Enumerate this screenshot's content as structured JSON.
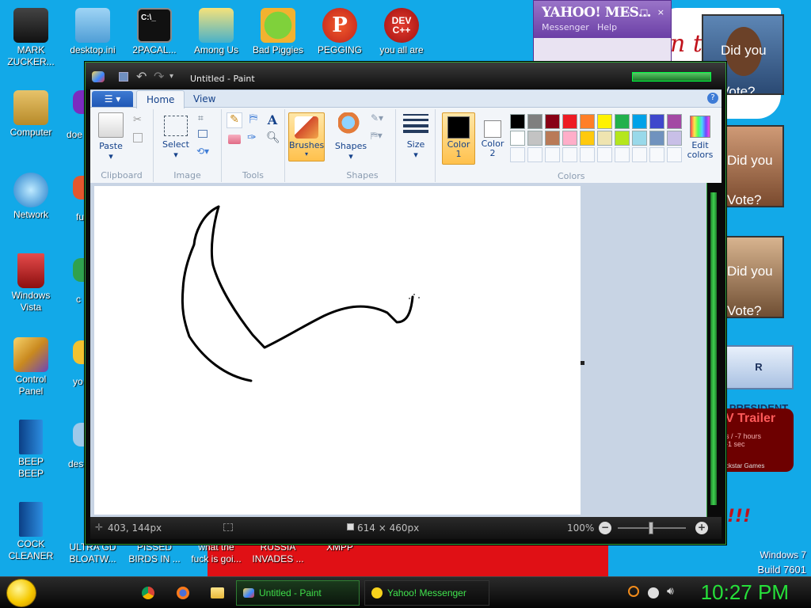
{
  "desktop": {
    "top_icons": [
      {
        "label": "MARK\nZUCKER..."
      },
      {
        "label": "desktop.ini"
      },
      {
        "label": "2PACAL..."
      },
      {
        "label": "Among Us"
      },
      {
        "label": "Bad Piggies"
      },
      {
        "label": "PEGGING"
      },
      {
        "label": "you all are"
      }
    ],
    "left_icons": [
      {
        "label": "Computer"
      },
      {
        "label": "Network"
      },
      {
        "label": "Windows\nVista"
      },
      {
        "label": "Control\nPanel"
      },
      {
        "label": "BEEP\nBEEP"
      },
      {
        "label": "COCK\nCLEANER"
      }
    ],
    "partial_labels": [
      "doe",
      "fu",
      "c",
      "yo",
      "des"
    ],
    "bottom_row": [
      {
        "label": "ULTRA GD\nBLOATW..."
      },
      {
        "label": "PISSED\nBIRDS IN ..."
      },
      {
        "label": "what the\nfuck is goi..."
      },
      {
        "label": "RUSSIA\nINVADES ..."
      },
      {
        "label": "XMPP"
      }
    ],
    "watermark": {
      "line1": "Windows 7",
      "line2": "Build 7601"
    },
    "posters": {
      "poster1_text": "Did you\nVote?",
      "poster2_text": "Did you\nVote?",
      "poster3_text": "Did you\nVote?",
      "president_banner": "R PRESIDENT",
      "trailer_title": "V Trailer",
      "trailer_sub": "s / -7 hours\n-1 sec",
      "trailer_foot": "ckstar Games",
      "bg_text": "n t",
      "exclaim": "!!!"
    }
  },
  "yahoo": {
    "title": "YAHOO! MES...",
    "menu_messenger": "Messenger",
    "menu_help": "Help",
    "controls": "— □ ×"
  },
  "paint": {
    "window_title": "Untitled - Paint",
    "tabs": {
      "home": "Home",
      "view": "View"
    },
    "ribbon": {
      "paste": "Paste",
      "clipboard": "Clipboard",
      "select": "Select",
      "image": "Image",
      "tools": "Tools",
      "brushes": "Brushes",
      "shapes": "Shapes",
      "shapes_group": "Shapes",
      "size": "Size",
      "color1": "Color\n1",
      "color2": "Color\n2",
      "edit_colors": "Edit\ncolors",
      "colors": "Colors"
    },
    "palette_row1": [
      "#000000",
      "#7f7f7f",
      "#880015",
      "#ed1c24",
      "#ff7f27",
      "#fff200",
      "#22b14c",
      "#00a2e8",
      "#3f48cc",
      "#a349a4"
    ],
    "palette_row2": [
      "#ffffff",
      "#c3c3c3",
      "#b97a57",
      "#ffaec9",
      "#ffc90e",
      "#efe4b0",
      "#b5e61d",
      "#99d9ea",
      "#7092be",
      "#c8bfe7"
    ],
    "status": {
      "cursor_pos": "403, 144px",
      "canvas_size": "614 × 460px",
      "zoom": "100%"
    }
  },
  "taskbar": {
    "paint_button": "Untitled - Paint",
    "yahoo_button": "Yahoo! Messenger",
    "clock": "10:27 PM"
  }
}
